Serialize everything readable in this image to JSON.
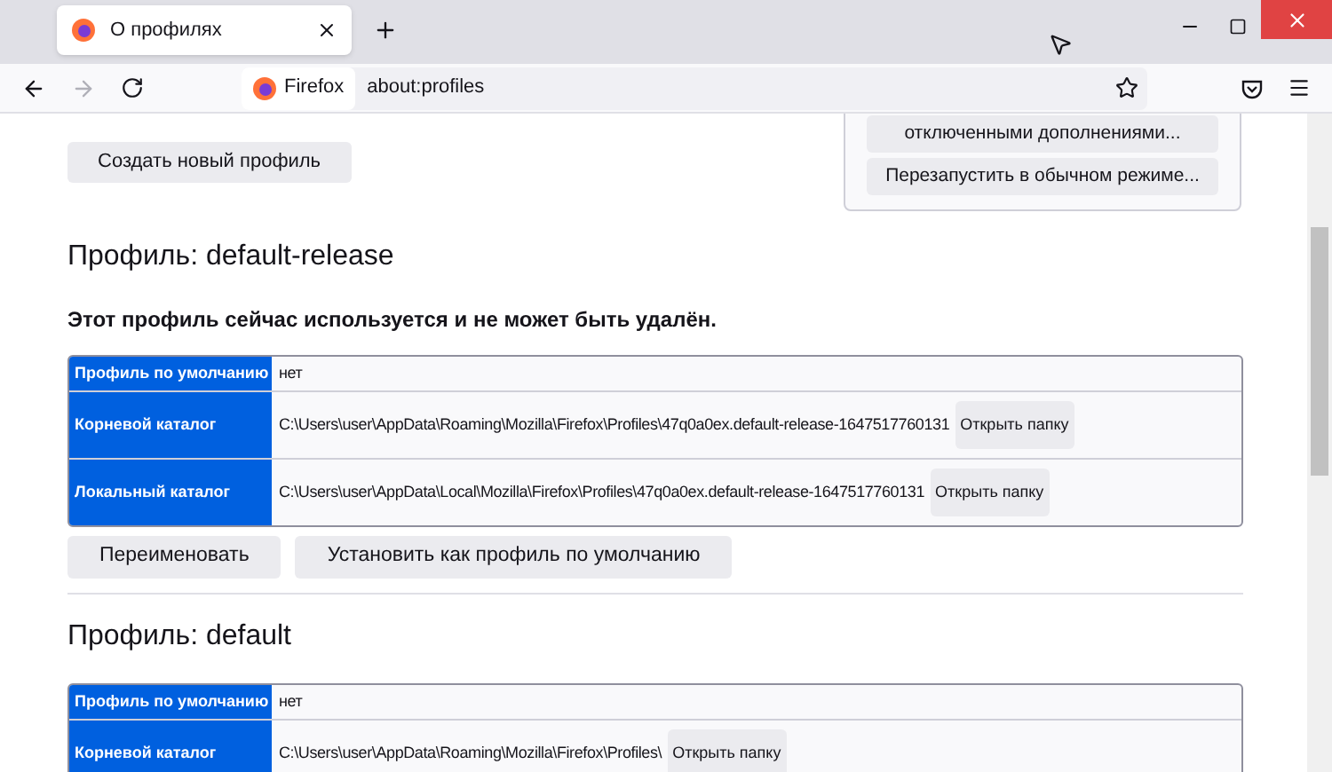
{
  "tab": {
    "title": "О профилях",
    "selected": true
  },
  "toolbar": {
    "identity": "Firefox",
    "url": "about:profiles"
  },
  "side_panel": {
    "buttons": [
      "отключенными дополнениями...",
      "Перезапустить в обычном режиме..."
    ]
  },
  "create_button": "Создать новый профиль",
  "profiles": [
    {
      "title": "Профиль: default-release",
      "notice": "Этот профиль сейчас используется и не может быть удалён.",
      "rows": [
        {
          "label": "Профиль по умолчанию",
          "value": "нет"
        },
        {
          "label": "Корневой каталог",
          "value": "C:\\Users\\user\\AppData\\Roaming\\Mozilla\\Firefox\\Profiles\\47q0a0ex.default-release-1647517760131",
          "button": "Открыть папку"
        },
        {
          "label": "Локальный каталог",
          "value": "C:\\Users\\user\\AppData\\Local\\Mozilla\\Firefox\\Profiles\\47q0a0ex.default-release-1647517760131",
          "button": "Открыть папку"
        }
      ],
      "buttons": [
        "Переименовать",
        "Установить как профиль по умолчанию"
      ]
    },
    {
      "title": "Профиль: default",
      "rows": [
        {
          "label": "Профиль по умолчанию",
          "value": "нет"
        },
        {
          "label": "Корневой каталог",
          "value": "C:\\Users\\user\\AppData\\Roaming\\Mozilla\\Firefox\\Profiles\\",
          "button": "Открыть папку"
        }
      ]
    }
  ]
}
